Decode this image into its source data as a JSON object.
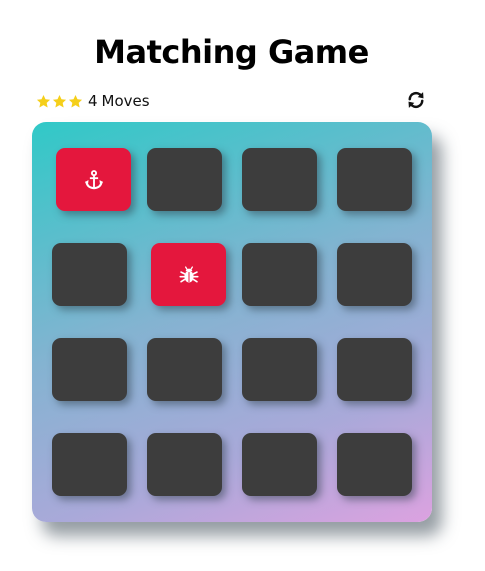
{
  "title": "Matching Game",
  "score_panel": {
    "stars": {
      "count": 3,
      "icon": "star-icon",
      "color": "#f5cf1a"
    },
    "moves_count": "4",
    "moves_label": "Moves",
    "restart_icon": "repeat-icon"
  },
  "deck": {
    "colors": {
      "card_closed": "#3d3d3d",
      "card_open": "#e4173d"
    },
    "cards": [
      {
        "state": "open",
        "icon": "anchor-icon"
      },
      {
        "state": "closed",
        "icon": ""
      },
      {
        "state": "closed",
        "icon": ""
      },
      {
        "state": "closed",
        "icon": ""
      },
      {
        "state": "closed",
        "icon": ""
      },
      {
        "state": "open",
        "icon": "bug-icon"
      },
      {
        "state": "closed",
        "icon": ""
      },
      {
        "state": "closed",
        "icon": ""
      },
      {
        "state": "closed",
        "icon": ""
      },
      {
        "state": "closed",
        "icon": ""
      },
      {
        "state": "closed",
        "icon": ""
      },
      {
        "state": "closed",
        "icon": ""
      },
      {
        "state": "closed",
        "icon": ""
      },
      {
        "state": "closed",
        "icon": ""
      },
      {
        "state": "closed",
        "icon": ""
      },
      {
        "state": "closed",
        "icon": ""
      }
    ]
  }
}
